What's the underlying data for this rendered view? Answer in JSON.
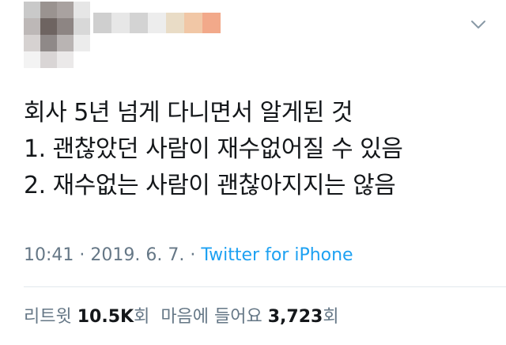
{
  "tweet": {
    "lines": [
      "회사 5년 넘게 다니면서 알게된 것",
      "1. 괜찮았던 사람이 재수없어질 수 있음",
      "2. 재수없는 사람이 괜찮아지지는 않음"
    ],
    "time": "10:41",
    "separator": "·",
    "date": "2019. 6. 7.",
    "source": "Twitter for iPhone",
    "retweets_label": "리트윗",
    "retweets_count": "10.5K",
    "retweets_unit": "회",
    "likes_label": "마음에 들어요",
    "likes_count": "3,723",
    "likes_unit": "회"
  },
  "icons": {
    "menu": "chevron-down-icon"
  },
  "colors": {
    "text": "#14171a",
    "secondary": "#657786",
    "link": "#1da1f2",
    "divider": "#e1e8ed"
  }
}
